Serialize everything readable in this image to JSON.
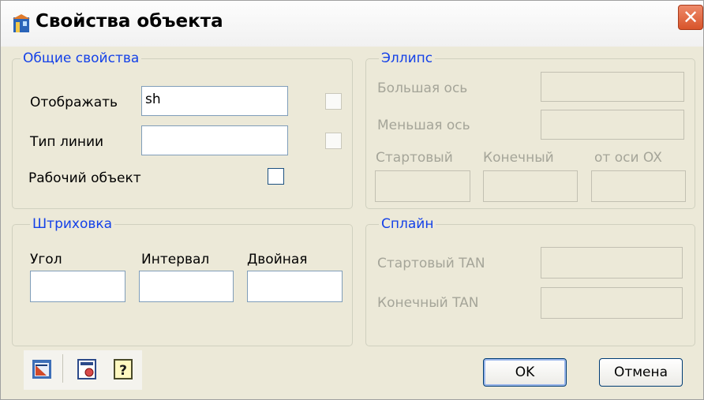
{
  "window": {
    "title": "Свойства объекта",
    "close_glyph": "✕"
  },
  "general": {
    "legend": "Общие свойства",
    "display_label": "Отображать",
    "display_value": "sh",
    "linetype_label": "Тип линии",
    "linetype_value": "",
    "working_object_label": "Рабочий объект"
  },
  "ellipse": {
    "legend": "Эллипс",
    "major_axis_label": "Большая ось",
    "minor_axis_label": "Меньшая ось",
    "start_label": "Стартовый",
    "end_label": "Конечный",
    "ox_label": "от оси OX"
  },
  "hatch": {
    "legend": "Штриховка",
    "angle_label": "Угол",
    "interval_label": "Интервал",
    "double_label": "Двойная"
  },
  "spline": {
    "legend": "Сплайн",
    "start_tan_label": "Стартовый TAN",
    "end_tan_label": "Конечный  TAN"
  },
  "buttons": {
    "ok": "OK",
    "cancel": "Отмена"
  },
  "icons": {
    "title": "house-icon",
    "tool1": "properties-icon",
    "tool2": "calculator-icon",
    "tool3": "help-icon"
  },
  "colors": {
    "accent": "#1441e8",
    "close": "#d8542a"
  }
}
